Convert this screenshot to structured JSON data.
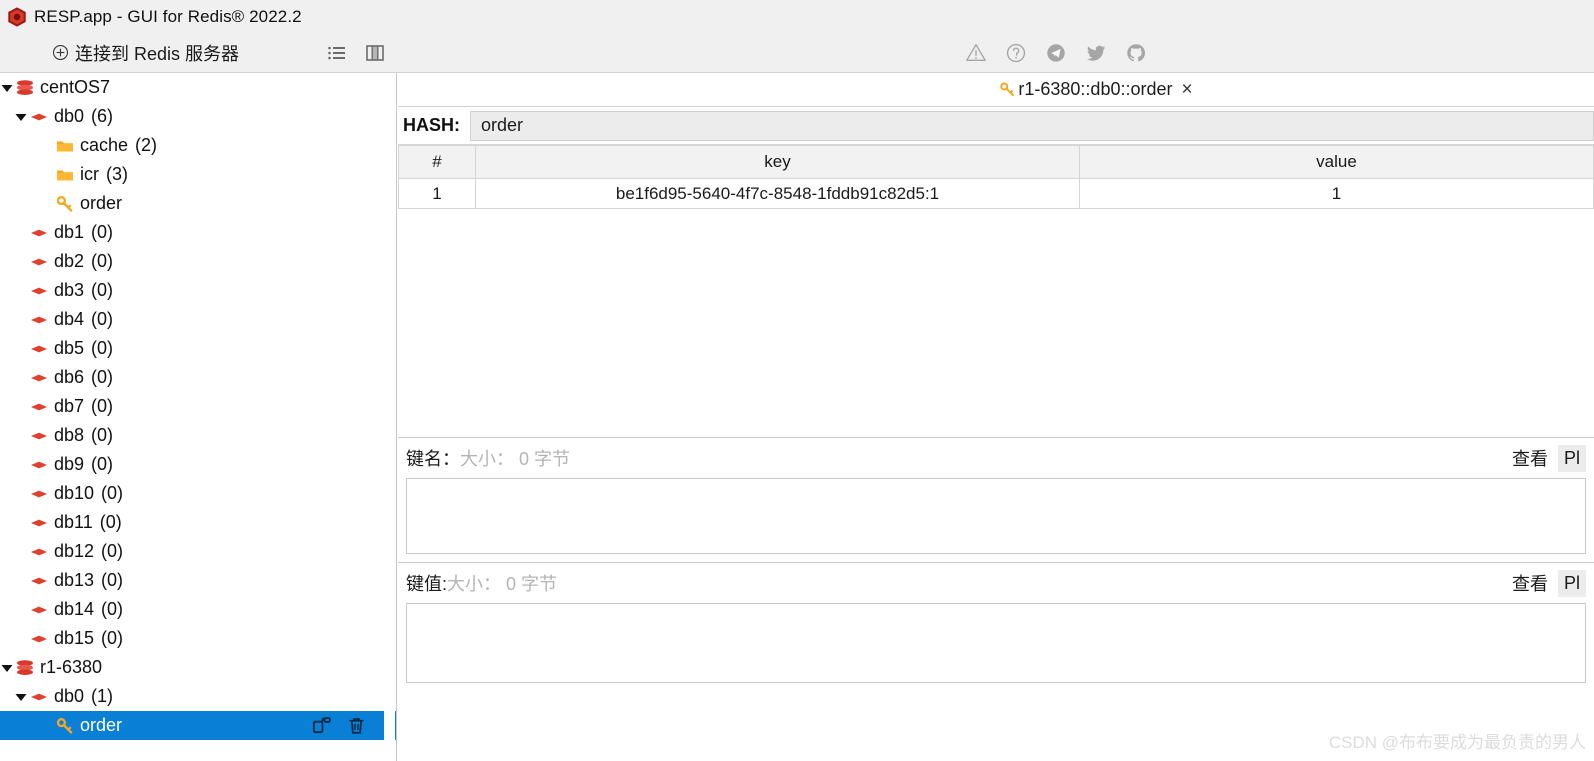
{
  "window": {
    "title": "RESP.app - GUI for Redis® 2022.2",
    "logo_icon": "redis-hexagon-logo"
  },
  "sidebar_header": {
    "connect_label": "连接到 Redis 服务器",
    "plus_icon": "plus-circle-icon",
    "list_icon": "list-view-icon",
    "split_icon": "split-panel-icon"
  },
  "toolbar_icons": [
    {
      "name": "warning-triangle-icon",
      "title": "warning"
    },
    {
      "name": "help-circle-icon",
      "title": "help"
    },
    {
      "name": "telegram-icon",
      "title": "telegram"
    },
    {
      "name": "twitter-icon",
      "title": "twitter"
    },
    {
      "name": "github-icon",
      "title": "github"
    }
  ],
  "tree": [
    {
      "label": "centOS7",
      "count": "",
      "icon": "redis-server-icon",
      "depth": 0,
      "caret": "down",
      "selected": false
    },
    {
      "label": "db0",
      "count": "(6)",
      "icon": "db-icon",
      "depth": 1,
      "caret": "down",
      "selected": false
    },
    {
      "label": "cache",
      "count": "(2)",
      "icon": "folder-icon",
      "depth": 2,
      "caret": "none",
      "selected": false
    },
    {
      "label": "icr",
      "count": "(3)",
      "icon": "folder-icon",
      "depth": 2,
      "caret": "none",
      "selected": false
    },
    {
      "label": "order",
      "count": "",
      "icon": "key-icon",
      "depth": 2,
      "caret": "none",
      "selected": false
    },
    {
      "label": "db1",
      "count": "(0)",
      "icon": "db-icon",
      "depth": 1,
      "caret": "none",
      "selected": false
    },
    {
      "label": "db2",
      "count": "(0)",
      "icon": "db-icon",
      "depth": 1,
      "caret": "none",
      "selected": false
    },
    {
      "label": "db3",
      "count": "(0)",
      "icon": "db-icon",
      "depth": 1,
      "caret": "none",
      "selected": false
    },
    {
      "label": "db4",
      "count": "(0)",
      "icon": "db-icon",
      "depth": 1,
      "caret": "none",
      "selected": false
    },
    {
      "label": "db5",
      "count": "(0)",
      "icon": "db-icon",
      "depth": 1,
      "caret": "none",
      "selected": false
    },
    {
      "label": "db6",
      "count": "(0)",
      "icon": "db-icon",
      "depth": 1,
      "caret": "none",
      "selected": false
    },
    {
      "label": "db7",
      "count": "(0)",
      "icon": "db-icon",
      "depth": 1,
      "caret": "none",
      "selected": false
    },
    {
      "label": "db8",
      "count": "(0)",
      "icon": "db-icon",
      "depth": 1,
      "caret": "none",
      "selected": false
    },
    {
      "label": "db9",
      "count": "(0)",
      "icon": "db-icon",
      "depth": 1,
      "caret": "none",
      "selected": false
    },
    {
      "label": "db10",
      "count": "(0)",
      "icon": "db-icon",
      "depth": 1,
      "caret": "none",
      "selected": false
    },
    {
      "label": "db11",
      "count": "(0)",
      "icon": "db-icon",
      "depth": 1,
      "caret": "none",
      "selected": false
    },
    {
      "label": "db12",
      "count": "(0)",
      "icon": "db-icon",
      "depth": 1,
      "caret": "none",
      "selected": false
    },
    {
      "label": "db13",
      "count": "(0)",
      "icon": "db-icon",
      "depth": 1,
      "caret": "none",
      "selected": false
    },
    {
      "label": "db14",
      "count": "(0)",
      "icon": "db-icon",
      "depth": 1,
      "caret": "none",
      "selected": false
    },
    {
      "label": "db15",
      "count": "(0)",
      "icon": "db-icon",
      "depth": 1,
      "caret": "none",
      "selected": false
    },
    {
      "label": "r1-6380",
      "count": "",
      "icon": "redis-server-icon",
      "depth": 0,
      "caret": "down",
      "selected": false
    },
    {
      "label": "db0",
      "count": "(1)",
      "icon": "db-icon",
      "depth": 1,
      "caret": "down",
      "selected": false
    },
    {
      "label": "order",
      "count": "",
      "icon": "key-icon",
      "depth": 2,
      "caret": "none",
      "selected": true,
      "actions": [
        "copy-key-icon",
        "delete-key-icon"
      ]
    }
  ],
  "tab": {
    "label": "r1-6380::db0::order",
    "key_icon": "key-icon",
    "close_label": "×"
  },
  "key_panel": {
    "type_label": "HASH:",
    "key_name": "order"
  },
  "table": {
    "columns": [
      "#",
      "key",
      "value"
    ],
    "rows": [
      {
        "index": "1",
        "key": "be1f6d95-5640-4f7c-8548-1fddb91c82d5:1",
        "value": "1"
      }
    ]
  },
  "editors": [
    {
      "label": "键名：",
      "size_text": "大小： 0 字节",
      "view_label": "查看",
      "format_label": "Pl",
      "value": ""
    },
    {
      "label": "键值:",
      "size_text": "大小： 0 字节",
      "view_label": "查看",
      "format_label": "Pl",
      "value": ""
    }
  ],
  "watermark": "CSDN @布布要成为最负责的男人",
  "colors": {
    "selection": "#0a7fd6",
    "redis_red": "#d9382c",
    "folder_orange": "#f5a623",
    "chrome": "#f0f0f0"
  }
}
